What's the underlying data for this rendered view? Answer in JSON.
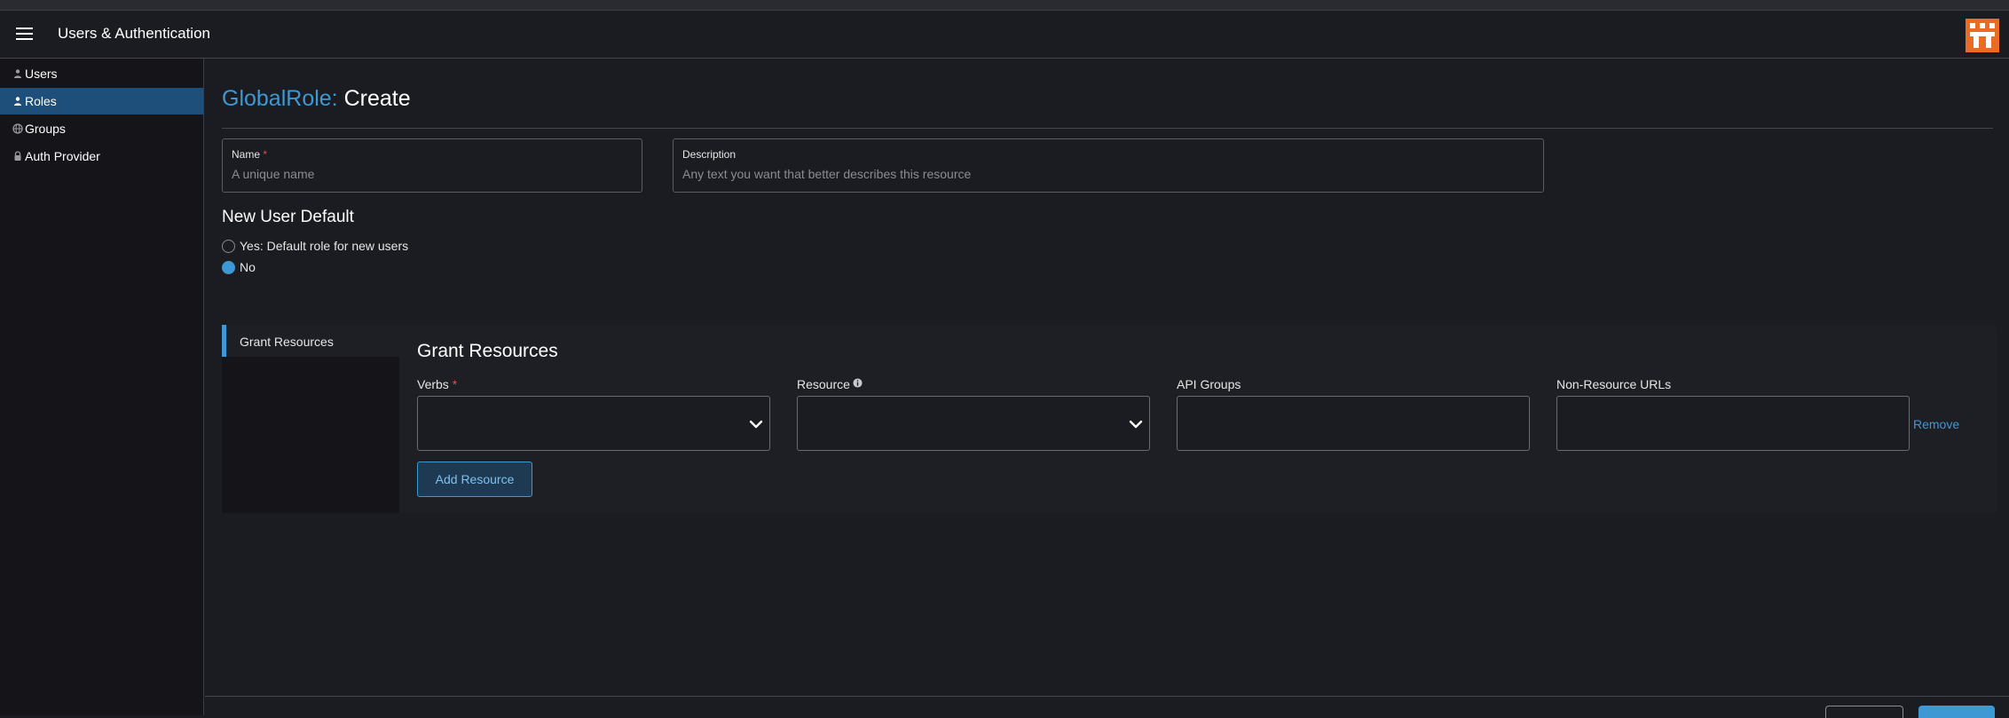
{
  "header": {
    "title": "Users & Authentication",
    "menu_icon": "hamburger-icon",
    "logo_icon": "rancher-logo-icon",
    "logo_colors": [
      "#e96b24",
      "#ffffff"
    ]
  },
  "sidebar": {
    "items": [
      {
        "label": "Users",
        "icon": "user-icon",
        "active": false
      },
      {
        "label": "Roles",
        "icon": "user-icon",
        "active": true
      },
      {
        "label": "Groups",
        "icon": "globe-icon",
        "active": false
      },
      {
        "label": "Auth Provider",
        "icon": "lock-icon",
        "active": false
      }
    ]
  },
  "page": {
    "title_prefix": "GlobalRole:",
    "title_action": "Create"
  },
  "form": {
    "name": {
      "label": "Name",
      "required_mark": "*",
      "value": "",
      "placeholder": "A unique name"
    },
    "description": {
      "label": "Description",
      "value": "",
      "placeholder": "Any text you want that better describes this resource"
    }
  },
  "new_user_default": {
    "title": "New User Default",
    "options": [
      {
        "label": "Yes: Default role for new users",
        "checked": false
      },
      {
        "label": "No",
        "checked": true
      }
    ]
  },
  "grant": {
    "tab_label": "Grant Resources",
    "heading": "Grant Resources",
    "verbs_label": "Verbs",
    "verbs_required": "*",
    "resource_label": "Resource",
    "api_groups_label": "API Groups",
    "non_resource_label": "Non-Resource URLs",
    "remove_label": "Remove",
    "add_resource_label": "Add Resource"
  },
  "colors": {
    "accent": "#3d98d3",
    "active_nav": "#1d4f7a",
    "required": "#e54b4b",
    "background": "#1b1c21"
  }
}
